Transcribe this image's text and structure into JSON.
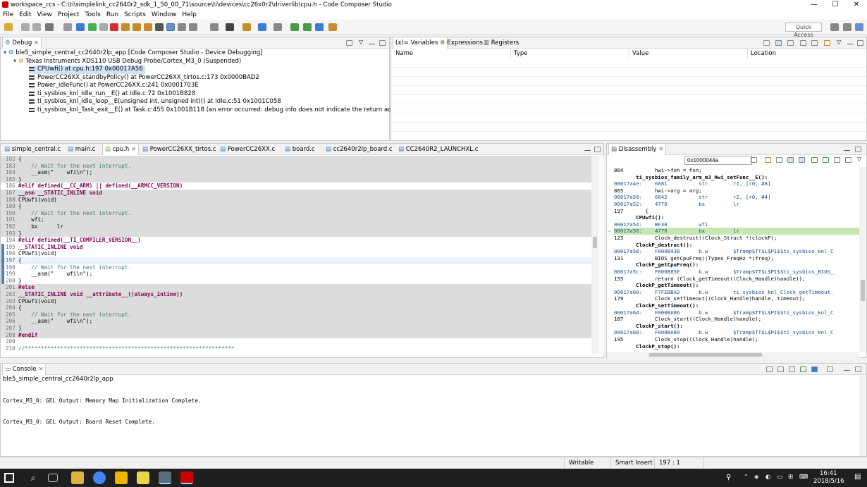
{
  "window": {
    "title": "workspace_ccs - C:\\ti\\simplelink_cc2640r2_sdk_1_50_00_71\\source\\ti\\devices\\cc26x0r2\\driverlib\\cpu.h - Code Composer Studio",
    "minimize": "—",
    "maximize": "☐",
    "close": "✕"
  },
  "menu": [
    "File",
    "Edit",
    "View",
    "Project",
    "Tools",
    "Run",
    "Scripts",
    "Window",
    "Help"
  ],
  "toolbar": {
    "quick_access": "Quick Access"
  },
  "debug": {
    "tab": "Debug",
    "root": "ble5_simple_central_cc2640r2lp_app [Code Composer Studio - Device Debugging]",
    "probe": "Texas Instruments XDS110 USB Debug Probe/Cortex_M3_0 (Suspended)",
    "frames": [
      "CPUwfi() at cpu.h:197 0x00017A56",
      "PowerCC26XX_standbyPolicy() at PowerCC26XX_tirtos.c:173 0x0000BAD2",
      "Power_idleFunc() at PowerCC26XX.c:241 0x0001703E",
      "ti_sysbios_knl_Idle_run__E() at Idle.c:72 0x1001B828",
      "ti_sysbios_knl_Idle_loop__E(unsigned int, unsigned int)() at Idle.c:51 0x1001C058",
      "ti_sysbios_knl_Task_exit__E() at Task.c:455 0x1001B118  (an error occurred: debug info does not indicate the return address)"
    ]
  },
  "variables": {
    "tabs": [
      "(x)= Variables",
      "Expressions",
      "Registers"
    ],
    "columns": [
      "Name",
      "Type",
      "Value",
      "Location"
    ]
  },
  "editor": {
    "tabs": [
      "simple_central.c",
      "main.c",
      "cpu.h",
      "PowerCC26XX_tirtos.c",
      "PowerCC26XX.c",
      "board.c",
      "cc2640r2lp_board.c",
      "CC2640R2_LAUNCHXL.c"
    ],
    "lines": [
      {
        "n": "182",
        "t": "{",
        "g": true
      },
      {
        "n": "183",
        "t": "    // Wait for the next interrupt.",
        "g": true,
        "c": "cm"
      },
      {
        "n": "184",
        "t": "    __asm(\"    wfi\\n\");",
        "g": true
      },
      {
        "n": "185",
        "t": "}",
        "g": true
      },
      {
        "n": "186",
        "t": "#elif defined(__CC_ARM) || defined(__ARMCC_VERSION)",
        "g": false,
        "c": "pp"
      },
      {
        "n": "187",
        "t": "__asm __STATIC_INLINE void",
        "g": true,
        "c": "kw"
      },
      {
        "n": "188",
        "t": "CPUwfi(void)",
        "g": true
      },
      {
        "n": "189",
        "t": "{",
        "g": true
      },
      {
        "n": "190",
        "t": "    // Wait for the next interrupt.",
        "g": true,
        "c": "cm"
      },
      {
        "n": "191",
        "t": "    wfi;",
        "g": true
      },
      {
        "n": "192",
        "t": "    bx      lr",
        "g": true
      },
      {
        "n": "193",
        "t": "}",
        "g": true
      },
      {
        "n": "194",
        "t": "#elif defined(__TI_COMPILER_VERSION__)",
        "g": false,
        "c": "pp"
      },
      {
        "n": "195",
        "t": "__STATIC_INLINE void",
        "g": false,
        "c": "kw"
      },
      {
        "n": "196",
        "t": "CPUwfi(void)",
        "g": false
      },
      {
        "n": "197",
        "t": "{",
        "g": false,
        "cur": true
      },
      {
        "n": "198",
        "t": "    // Wait for the next interrupt.",
        "g": false,
        "c": "cm"
      },
      {
        "n": "199",
        "t": "    __asm(\"    wfi\\n\");",
        "g": false
      },
      {
        "n": "200",
        "t": "}",
        "g": false
      },
      {
        "n": "201",
        "t": "#else",
        "g": true,
        "c": "pp"
      },
      {
        "n": "202",
        "t": "__STATIC_INLINE void __attribute__((always_inline))",
        "g": true,
        "c": "kw"
      },
      {
        "n": "203",
        "t": "CPUwfi(void)",
        "g": true
      },
      {
        "n": "204",
        "t": "{",
        "g": true
      },
      {
        "n": "205",
        "t": "    // Wait for the next interrupt.",
        "g": true,
        "c": "cm"
      },
      {
        "n": "206",
        "t": "    __asm(\"    wfi\\n\");",
        "g": true
      },
      {
        "n": "207",
        "t": "}",
        "g": true
      },
      {
        "n": "208",
        "t": "#endif",
        "g": true,
        "c": "pp"
      },
      {
        "n": "209",
        "t": "",
        "g": false
      },
      {
        "n": "210",
        "t": "//*****************************************************************",
        "g": false,
        "c": "cm"
      }
    ]
  },
  "disassembly": {
    "tab": "Disassembly",
    "address": "0x1000044a",
    "lines": [
      {
        "t": "864          hwi->fxn = fxn;",
        "k": "src"
      },
      {
        "t": "       ti_sysbios_family_arm_m3_Hwi_setFunc__E():",
        "k": "lbl"
      },
      {
        "t": "00017a4e:    6081          str        r1, [r0, #8]",
        "k": "asm"
      },
      {
        "t": "865          hwi->arg = arg;",
        "k": "src"
      },
      {
        "t": "00017a50:    6042          str        r2, [r0, #4]",
        "k": "asm"
      },
      {
        "t": "00017a52:    4770          bx         lr",
        "k": "asm"
      },
      {
        "t": "197       {",
        "k": "src"
      },
      {
        "t": "       CPUwfi():",
        "k": "lbl"
      },
      {
        "t": "00017a54:    BF30          wfi",
        "k": "asm"
      },
      {
        "t": "00017a56:    4770          bx         lr",
        "k": "cur"
      },
      {
        "t": "123          Clock_destruct((Clock_Struct *)clockP);",
        "k": "src"
      },
      {
        "t": "       ClockP_destruct():",
        "k": "lbl"
      },
      {
        "t": "00017a58:    F000B938      b.w        $Tramp$TT$L$PI$$ti_sysbios_knl_C",
        "k": "asm"
      },
      {
        "t": "131          BIOS_getCpuFreq((Types_FreqHz *)freq);",
        "k": "src"
      },
      {
        "t": "       ClockP_getCpuFreq():",
        "k": "lbl"
      },
      {
        "t": "00017a5c:    F000B85E      b.w        $Tramp$TT$L$PI$$ti_sysbios_BIOS_",
        "k": "asm"
      },
      {
        "t": "155          return (Clock_getTimeout((Clock_Handle)handle));",
        "k": "src"
      },
      {
        "t": "       ClockP_getTimeout():",
        "k": "lbl"
      },
      {
        "t": "00017a60:    F7FEBBA2      b.w        ti_sysbios_knl_Clock_getTimeout_",
        "k": "asm"
      },
      {
        "t": "179          Clock_setTimeout((Clock_Handle)handle, timeout);",
        "k": "src"
      },
      {
        "t": "       ClockP_setTimeout():",
        "k": "lbl"
      },
      {
        "t": "00017a64:    F000BA86      b.w        $Tramp$TT$L$PI$$ti_sysbios_knl_C",
        "k": "asm"
      },
      {
        "t": "187          Clock_start((Clock_Handle)handle);",
        "k": "src"
      },
      {
        "t": "       ClockP_start():",
        "k": "lbl"
      },
      {
        "t": "00017a68:    F000BA80      b.w        $Tramp$TT$L$PI$$ti_sysbios_knl_C",
        "k": "asm"
      },
      {
        "t": "195          Clock_stop((Clock_Handle)handle);",
        "k": "src"
      },
      {
        "t": "       ClockP_stop():",
        "k": "lbl"
      }
    ]
  },
  "console": {
    "tab": "Console",
    "subtitle": "ble5_simple_central_cc2640r2lp_app",
    "lines": [
      "Cortex_M3_0: GEL Output: Memory Map Initialization Complete.",
      "Cortex_M3_0: GEL Output: Board Reset Complete."
    ]
  },
  "status": {
    "writable": "Writable",
    "insert": "Smart Insert",
    "pos": "197 : 1"
  },
  "taskbar": {
    "time": "16:41",
    "date": "2018/5/16"
  },
  "colors": {
    "current_line": "#c8e6b4",
    "grey_block": "#dcdcdc",
    "taskbar": "#1f1f1f"
  }
}
